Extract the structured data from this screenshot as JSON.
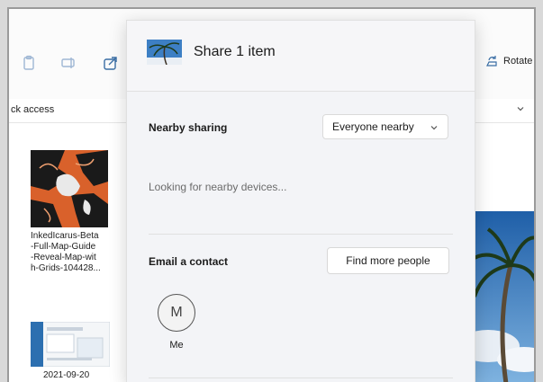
{
  "explorer": {
    "address_text": "ck access",
    "rotate_label": "Rotate",
    "files": [
      {
        "name": "InkedIcarus-Beta-Full-Map-Guide-Reveal-Map-with-Grids-104428...",
        "lines": [
          "InkedIcarus-Beta",
          "-Full-Map-Guide",
          "-Reveal-Map-wit",
          "h-Grids-104428..."
        ]
      },
      {
        "name": "2021-09-20",
        "lines": [
          "2021-09-20"
        ]
      }
    ]
  },
  "share": {
    "title": "Share 1 item",
    "nearby_label": "Nearby sharing",
    "nearby_option": "Everyone nearby",
    "nearby_status": "Looking for nearby devices...",
    "email_label": "Email a contact",
    "find_people_label": "Find more people",
    "contact": {
      "initial": "M",
      "name": "Me"
    }
  },
  "colors": {
    "accent": "#3a6ea5",
    "panel_bg": "#f3f4f7"
  }
}
